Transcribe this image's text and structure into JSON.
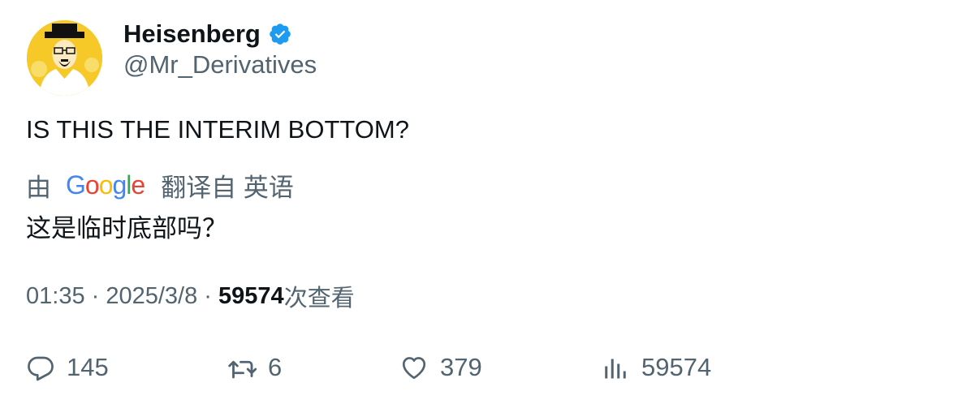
{
  "author": {
    "display_name": "Heisenberg",
    "handle": "@Mr_Derivatives",
    "verified_icon": "verified-badge-icon"
  },
  "tweet": {
    "text": "IS THIS THE INTERIM BOTTOM?"
  },
  "translation": {
    "by_label": "由",
    "provider": "Google",
    "translated_from": "翻译自 英语",
    "text": "这是临时底部吗？"
  },
  "meta": {
    "time": "01:35",
    "sep1": " · ",
    "date": "2025/3/8",
    "sep2": " · ",
    "views": "59574",
    "views_label": "次查看"
  },
  "actions": {
    "replies": "145",
    "retweets": "6",
    "likes": "379",
    "views": "59574"
  },
  "colors": {
    "text": "#0f1419",
    "secondary": "#536471",
    "verified": "#1d9bf0",
    "avatar_bg": "#f6c928"
  }
}
